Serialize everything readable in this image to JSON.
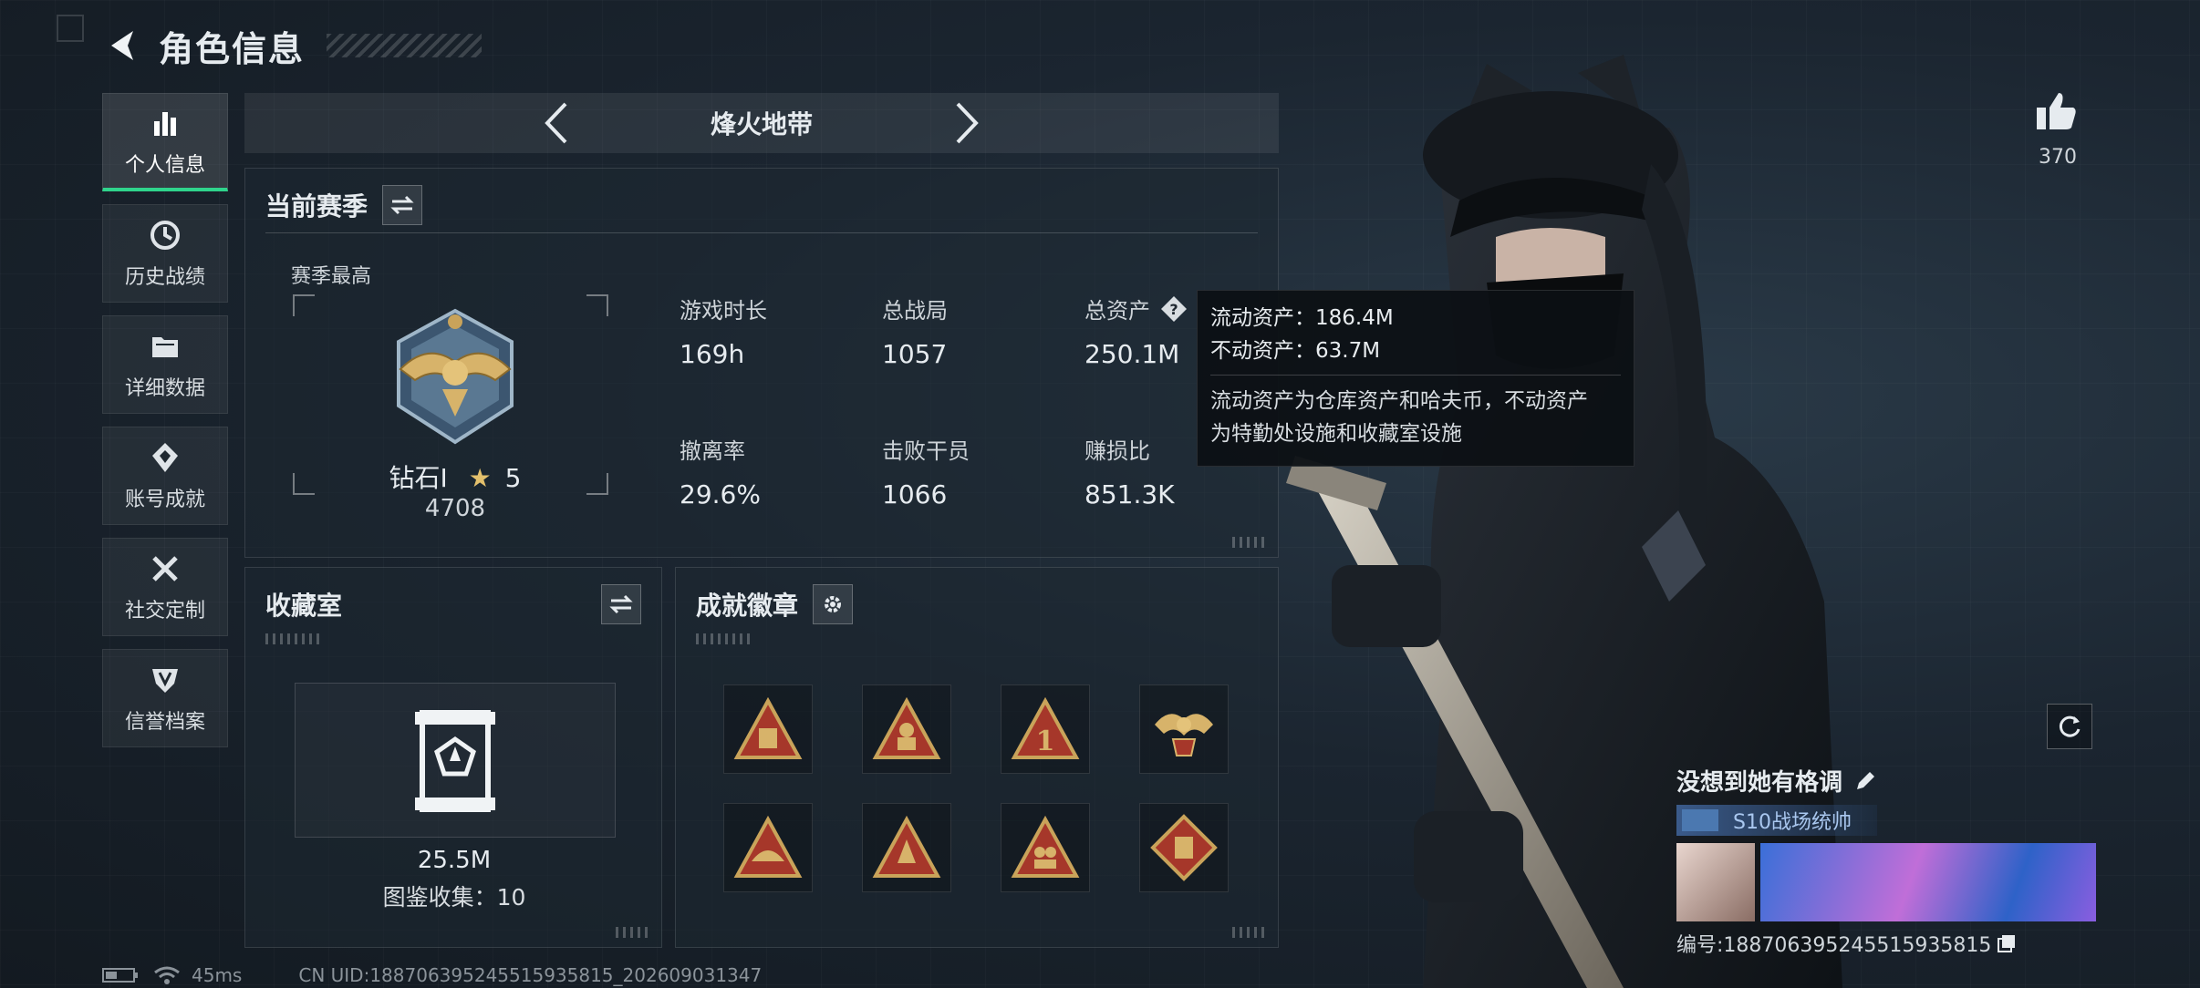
{
  "header": {
    "title": "角色信息"
  },
  "sidebar": {
    "items": [
      {
        "label": "个人信息",
        "icon": "bar-chart-icon",
        "active": true
      },
      {
        "label": "历史战绩",
        "icon": "history-clock-icon"
      },
      {
        "label": "详细数据",
        "icon": "folder-icon"
      },
      {
        "label": "账号成就",
        "icon": "achievement-icon"
      },
      {
        "label": "社交定制",
        "icon": "tools-icon"
      },
      {
        "label": "信誉档案",
        "icon": "shield-icon"
      }
    ]
  },
  "mode": {
    "title": "烽火地带"
  },
  "season": {
    "title": "当前赛季",
    "best_label": "赛季最高",
    "rank_name": "钻石Ⅰ",
    "rank_stars": "5",
    "rank_score": "4708",
    "stats": [
      {
        "label": "游戏时长",
        "value": "169h"
      },
      {
        "label": "总战局",
        "value": "1057"
      },
      {
        "label": "总资产",
        "value": "250.1M"
      },
      {
        "label": "撤离率",
        "value": "29.6%"
      },
      {
        "label": "击败干员",
        "value": "1066"
      },
      {
        "label": "赚损比",
        "value": "851.3K"
      }
    ]
  },
  "tooltip": {
    "liquid": "流动资产：186.4M",
    "fixed": "不动资产：63.7M",
    "desc_line1": "流动资产为仓库资产和哈夫币，不动资产",
    "desc_line2": "为特勤处设施和收藏室设施"
  },
  "collection": {
    "title": "收藏室",
    "value": "25.5M",
    "count": "图鉴收集：10"
  },
  "badges": {
    "title": "成就徽章"
  },
  "likes": {
    "count": "370"
  },
  "card": {
    "name": "没想到她有格调",
    "title": "S10战场统帅",
    "id": "编号:18870639524551593581​5"
  },
  "footer": {
    "ping": "45ms",
    "uid": "CN UID:18870639524551593581​5_202609031347"
  },
  "colors": {
    "accent_green": "#2fd48c",
    "gold": "#c9a35a",
    "badge_red": "#a6372a"
  }
}
